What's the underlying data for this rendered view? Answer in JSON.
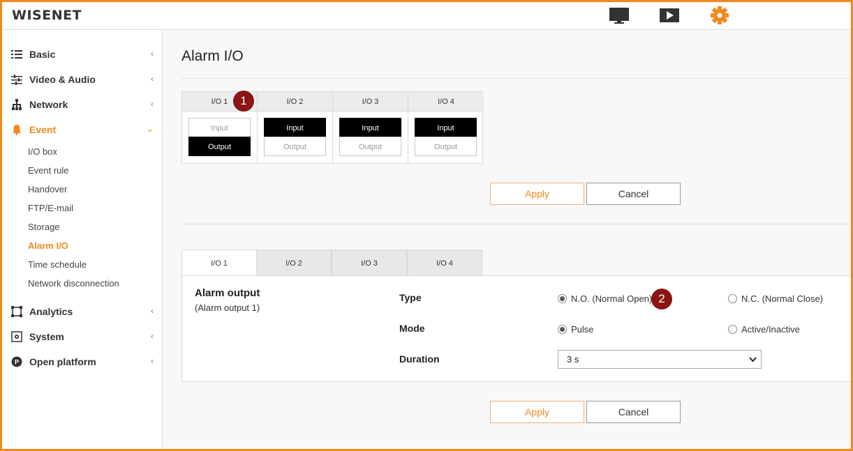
{
  "brand": {
    "logo": "WISENET",
    "accent": "#f0891f"
  },
  "header": {
    "icons": [
      "monitor-icon",
      "playback-icon",
      "settings-gear-icon"
    ]
  },
  "sidebar": {
    "items": [
      {
        "label": "Basic",
        "icon": "list-icon",
        "chevron": "‹"
      },
      {
        "label": "Video & Audio",
        "icon": "sliders-icon",
        "chevron": "‹"
      },
      {
        "label": "Network",
        "icon": "network-tree-icon",
        "chevron": "‹"
      },
      {
        "label": "Event",
        "icon": "bell-icon",
        "chevron": "⌄"
      },
      {
        "label": "Analytics",
        "icon": "frame-icon",
        "chevron": "‹"
      },
      {
        "label": "System",
        "icon": "gear-box-icon",
        "chevron": "‹"
      },
      {
        "label": "Open platform",
        "icon": "p-circle-icon",
        "chevron": "‹"
      }
    ],
    "event_sub": [
      "I/O box",
      "Event rule",
      "Handover",
      "FTP/E-mail",
      "Storage",
      "Alarm I/O",
      "Time schedule",
      "Network disconnection"
    ]
  },
  "main": {
    "title": "Alarm I/O",
    "io_grid": {
      "columns": [
        {
          "label": "I/O 1",
          "input": "Input",
          "output": "Output",
          "selected": "output"
        },
        {
          "label": "I/O 2",
          "input": "Input",
          "output": "Output",
          "selected": "input"
        },
        {
          "label": "I/O 3",
          "input": "Input",
          "output": "Output",
          "selected": "input"
        },
        {
          "label": "I/O 4",
          "input": "Input",
          "output": "Output",
          "selected": "input"
        }
      ]
    },
    "apply_label": "Apply",
    "cancel_label": "Cancel",
    "tabs": [
      "I/O 1",
      "I/O 2",
      "I/O 3",
      "I/O 4"
    ],
    "section": {
      "title": "Alarm output",
      "subtitle": "(Alarm output 1)",
      "type_label": "Type",
      "type_options": [
        "N.O. (Normal Open)",
        "N.C. (Normal Close)"
      ],
      "mode_label": "Mode",
      "mode_options": [
        "Pulse",
        "Active/Inactive"
      ],
      "duration_label": "Duration",
      "duration_value": "3 s"
    },
    "badges": [
      "1",
      "2"
    ]
  }
}
